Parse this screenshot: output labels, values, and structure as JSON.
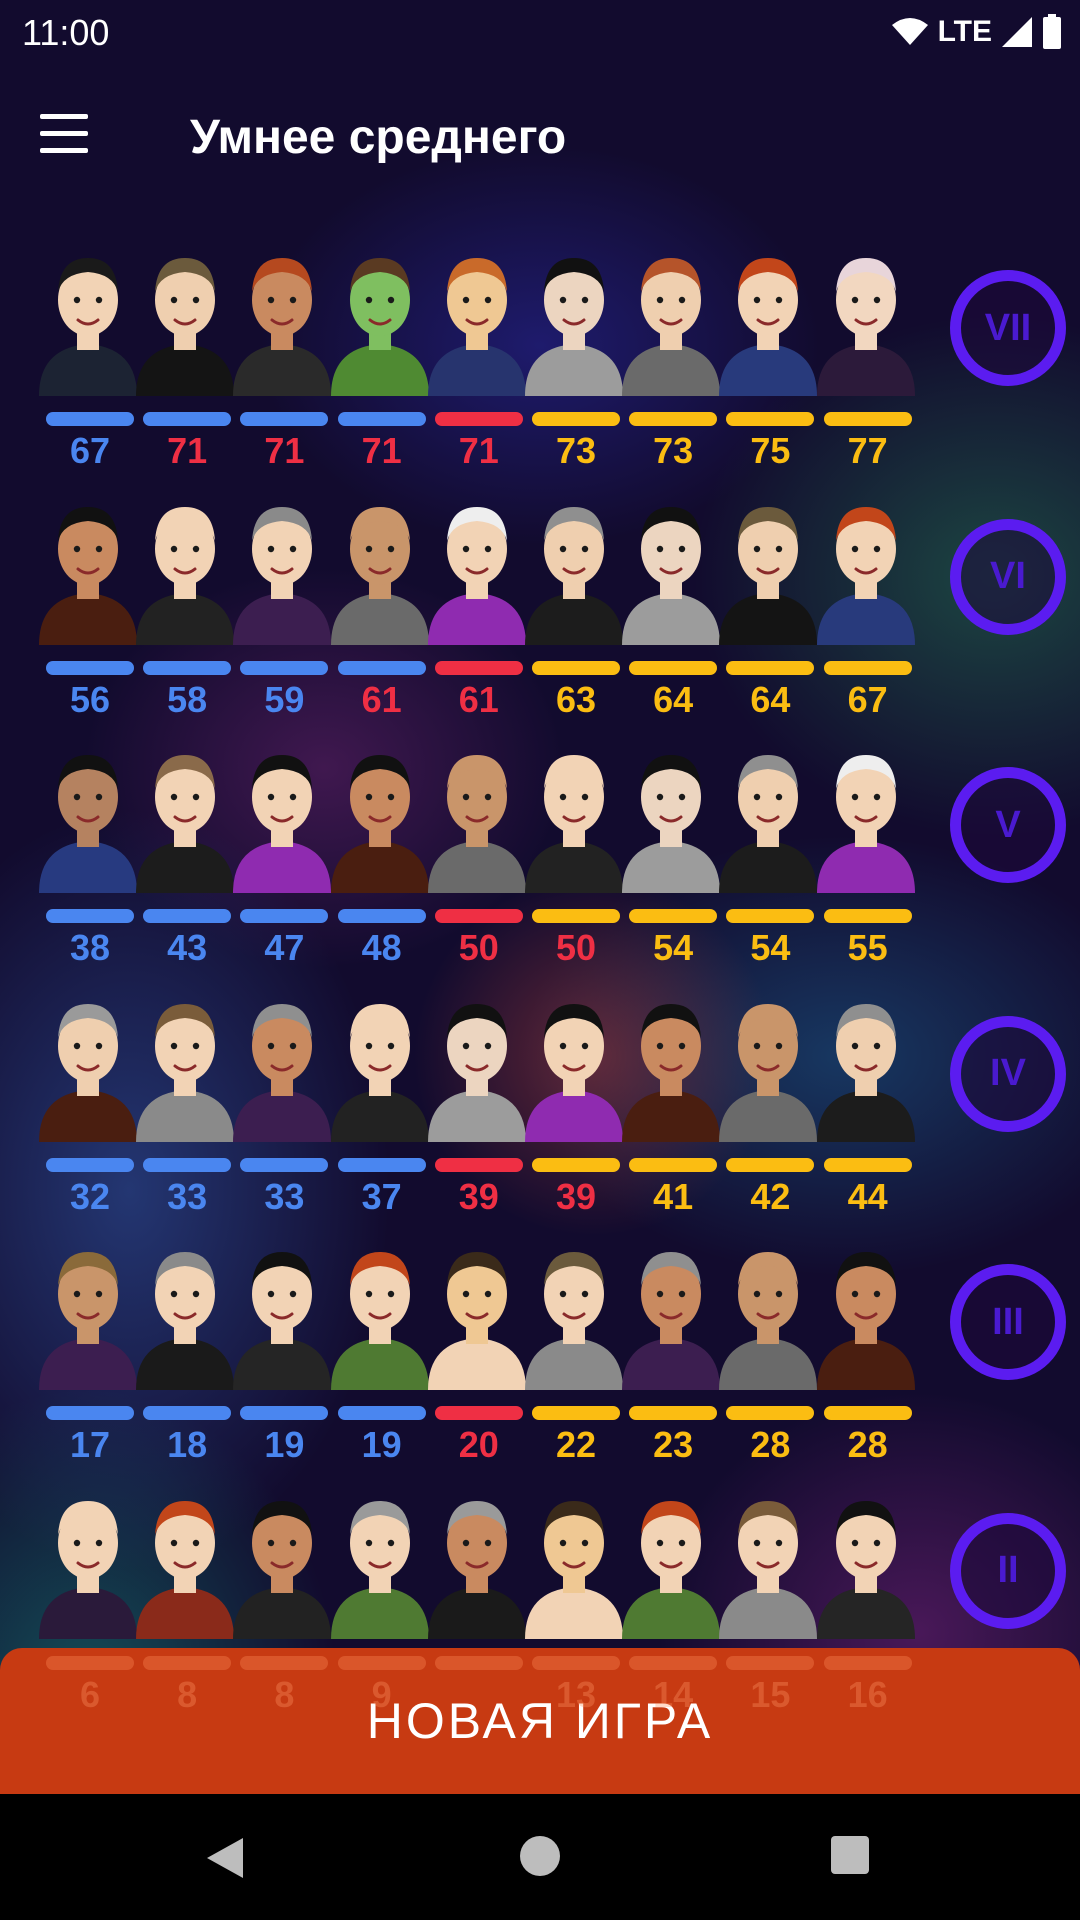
{
  "status_bar": {
    "time": "11:00",
    "network": "LTE"
  },
  "app_bar": {
    "title": "Умнее среднего"
  },
  "colors": {
    "blue": "#4a86f0",
    "red": "#ef2f44",
    "gold": "#fbbd12",
    "badge": "#5b1cf0",
    "button": "#c73a12"
  },
  "levels": [
    {
      "badge": "VII",
      "scores": [
        {
          "value": "67",
          "tone": "blue"
        },
        {
          "value": "71",
          "tone": "red"
        },
        {
          "value": "71",
          "tone": "red"
        },
        {
          "value": "71",
          "tone": "red"
        },
        {
          "value": "71",
          "tone": "red"
        },
        {
          "value": "73",
          "tone": "gold"
        },
        {
          "value": "73",
          "tone": "gold"
        },
        {
          "value": "75",
          "tone": "gold"
        },
        {
          "value": "77",
          "tone": "gold"
        }
      ],
      "bars": [
        "blue",
        "blue",
        "blue",
        "blue",
        "red",
        "gold",
        "gold",
        "gold",
        "gold"
      ]
    },
    {
      "badge": "VI",
      "scores": [
        {
          "value": "56",
          "tone": "blue"
        },
        {
          "value": "58",
          "tone": "blue"
        },
        {
          "value": "59",
          "tone": "blue"
        },
        {
          "value": "61",
          "tone": "red"
        },
        {
          "value": "61",
          "tone": "red"
        },
        {
          "value": "63",
          "tone": "gold"
        },
        {
          "value": "64",
          "tone": "gold"
        },
        {
          "value": "64",
          "tone": "gold"
        },
        {
          "value": "67",
          "tone": "gold"
        }
      ],
      "bars": [
        "blue",
        "blue",
        "blue",
        "blue",
        "red",
        "gold",
        "gold",
        "gold",
        "gold"
      ]
    },
    {
      "badge": "V",
      "scores": [
        {
          "value": "38",
          "tone": "blue"
        },
        {
          "value": "43",
          "tone": "blue"
        },
        {
          "value": "47",
          "tone": "blue"
        },
        {
          "value": "48",
          "tone": "blue"
        },
        {
          "value": "50",
          "tone": "red"
        },
        {
          "value": "50",
          "tone": "red"
        },
        {
          "value": "54",
          "tone": "gold"
        },
        {
          "value": "54",
          "tone": "gold"
        },
        {
          "value": "55",
          "tone": "gold"
        }
      ],
      "bars": [
        "blue",
        "blue",
        "blue",
        "blue",
        "red",
        "gold",
        "gold",
        "gold",
        "gold"
      ]
    },
    {
      "badge": "IV",
      "scores": [
        {
          "value": "32",
          "tone": "blue"
        },
        {
          "value": "33",
          "tone": "blue"
        },
        {
          "value": "33",
          "tone": "blue"
        },
        {
          "value": "37",
          "tone": "blue"
        },
        {
          "value": "39",
          "tone": "red"
        },
        {
          "value": "39",
          "tone": "red"
        },
        {
          "value": "41",
          "tone": "gold"
        },
        {
          "value": "42",
          "tone": "gold"
        },
        {
          "value": "44",
          "tone": "gold"
        }
      ],
      "bars": [
        "blue",
        "blue",
        "blue",
        "blue",
        "red",
        "gold",
        "gold",
        "gold",
        "gold"
      ]
    },
    {
      "badge": "III",
      "scores": [
        {
          "value": "17",
          "tone": "blue"
        },
        {
          "value": "18",
          "tone": "blue"
        },
        {
          "value": "19",
          "tone": "blue"
        },
        {
          "value": "19",
          "tone": "blue"
        },
        {
          "value": "20",
          "tone": "red"
        },
        {
          "value": "22",
          "tone": "gold"
        },
        {
          "value": "23",
          "tone": "gold"
        },
        {
          "value": "28",
          "tone": "gold"
        },
        {
          "value": "28",
          "tone": "gold"
        }
      ],
      "bars": [
        "blue",
        "blue",
        "blue",
        "blue",
        "red",
        "gold",
        "gold",
        "gold",
        "gold"
      ]
    },
    {
      "badge": "II",
      "scores": [],
      "bars": []
    }
  ],
  "hidden_row_scores": [
    "6",
    "8",
    "8",
    "9",
    "",
    "13",
    "14",
    "15",
    "16"
  ],
  "new_game_button": "НОВАЯ ИГРА",
  "avatars": [
    [
      {
        "skin": "#f2d3b5",
        "hair": "#1a1a1a",
        "shirt": "#1c2333"
      },
      {
        "skin": "#efcfaf",
        "hair": "#6b5a3c",
        "shirt": "#141414"
      },
      {
        "skin": "#c98a60",
        "hair": "#b5491f",
        "shirt": "#2a2a2a"
      },
      {
        "skin": "#7fbf60",
        "hair": "#5a3a22",
        "shirt": "#4f8a32"
      },
      {
        "skin": "#efc893",
        "hair": "#c96a2a",
        "shirt": "#27346e"
      },
      {
        "skin": "#ecd5c0",
        "hair": "#111111",
        "shirt": "#9c9c9c"
      },
      {
        "skin": "#efcfaf",
        "hair": "#b5542a",
        "shirt": "#6a6a6a"
      },
      {
        "skin": "#f2d3b5",
        "hair": "#c2461a",
        "shirt": "#283a7c"
      },
      {
        "skin": "#f2d7c0",
        "hair": "#e8d5da",
        "shirt": "#2c1a3a"
      }
    ],
    [
      {
        "skin": "#c98a60",
        "hair": "#111111",
        "shirt": "#4a1e10"
      },
      {
        "skin": "#f2d3b5",
        "hair": "#f2d3b5",
        "shirt": "#222222"
      },
      {
        "skin": "#f2d3b5",
        "hair": "#8a8a8a",
        "shirt": "#3c1e50"
      },
      {
        "skin": "#c9956a",
        "hair": "#c9956a",
        "shirt": "#6a6a6a"
      },
      {
        "skin": "#f2d3b5",
        "hair": "#eeeeee",
        "shirt": "#8f2bb0"
      },
      {
        "skin": "#efcfaf",
        "hair": "#8f8f8f",
        "shirt": "#1c1c1c"
      },
      {
        "skin": "#ecd5c0",
        "hair": "#111111",
        "shirt": "#9c9c9c"
      },
      {
        "skin": "#efcfaf",
        "hair": "#6b5a3c",
        "shirt": "#141414"
      },
      {
        "skin": "#f2d3b5",
        "hair": "#c2461a",
        "shirt": "#283a7c"
      }
    ],
    [
      {
        "skin": "#b58260",
        "hair": "#111111",
        "shirt": "#273a80"
      },
      {
        "skin": "#f2d3b5",
        "hair": "#8a6a4a",
        "shirt": "#1c1c1c"
      },
      {
        "skin": "#f2d3b5",
        "hair": "#111111",
        "shirt": "#8f2bb0"
      },
      {
        "skin": "#c98a60",
        "hair": "#111111",
        "shirt": "#4a1e10"
      },
      {
        "skin": "#c9956a",
        "hair": "#c9956a",
        "shirt": "#6a6a6a"
      },
      {
        "skin": "#f2d3b5",
        "hair": "#f2d3b5",
        "shirt": "#222222"
      },
      {
        "skin": "#ecd5c0",
        "hair": "#111111",
        "shirt": "#9c9c9c"
      },
      {
        "skin": "#efcfaf",
        "hair": "#8f8f8f",
        "shirt": "#1c1c1c"
      },
      {
        "skin": "#f2d3b5",
        "hair": "#eeeeee",
        "shirt": "#8f2bb0"
      }
    ],
    [
      {
        "skin": "#efcfaf",
        "hair": "#9a9a9a",
        "shirt": "#4a1e10"
      },
      {
        "skin": "#f2d3b5",
        "hair": "#7a5c3a",
        "shirt": "#8a8a8a"
      },
      {
        "skin": "#c98a60",
        "hair": "#8f8f8f",
        "shirt": "#3c1e50"
      },
      {
        "skin": "#f2d3b5",
        "hair": "#f2d3b5",
        "shirt": "#222222"
      },
      {
        "skin": "#ecd5c0",
        "hair": "#111111",
        "shirt": "#9c9c9c"
      },
      {
        "skin": "#f2d3b5",
        "hair": "#111111",
        "shirt": "#8f2bb0"
      },
      {
        "skin": "#c98a60",
        "hair": "#111111",
        "shirt": "#4a1e10"
      },
      {
        "skin": "#c9956a",
        "hair": "#c9956a",
        "shirt": "#6a6a6a"
      },
      {
        "skin": "#efcfaf",
        "hair": "#8f8f8f",
        "shirt": "#1c1c1c"
      }
    ],
    [
      {
        "skin": "#c9956a",
        "hair": "#8a6a3a",
        "shirt": "#3c1e50"
      },
      {
        "skin": "#f2d3b5",
        "hair": "#8a8a8a",
        "shirt": "#1a1a1a"
      },
      {
        "skin": "#f2d3b5",
        "hair": "#111111",
        "shirt": "#252525"
      },
      {
        "skin": "#f2d3b5",
        "hair": "#c2461a",
        "shirt": "#4f7a32"
      },
      {
        "skin": "#efc893",
        "hair": "#3a2a1a",
        "shirt": "#f2d3b5"
      },
      {
        "skin": "#f2d3b5",
        "hair": "#6b5a3c",
        "shirt": "#8a8a8a"
      },
      {
        "skin": "#c98a60",
        "hair": "#8f8f8f",
        "shirt": "#3c1e50"
      },
      {
        "skin": "#c9956a",
        "hair": "#c9956a",
        "shirt": "#6a6a6a"
      },
      {
        "skin": "#c98a60",
        "hair": "#111111",
        "shirt": "#4a1e10"
      }
    ],
    [
      {
        "skin": "#f2d3b5",
        "hair": "#f2d3b5",
        "shirt": "#2a1a3a"
      },
      {
        "skin": "#f2d3b5",
        "hair": "#c2461a",
        "shirt": "#8a2a1a"
      },
      {
        "skin": "#c98a60",
        "hair": "#111111",
        "shirt": "#222222"
      },
      {
        "skin": "#f2d3b5",
        "hair": "#9a9a9a",
        "shirt": "#4f7a32"
      },
      {
        "skin": "#c98a60",
        "hair": "#9a9a9a",
        "shirt": "#1a1a1a"
      },
      {
        "skin": "#efc893",
        "hair": "#3a2a1a",
        "shirt": "#f2d3b5"
      },
      {
        "skin": "#f2d3b5",
        "hair": "#c2461a",
        "shirt": "#4f7a32"
      },
      {
        "skin": "#f2d3b5",
        "hair": "#7a5c3a",
        "shirt": "#8a8a8a"
      },
      {
        "skin": "#f2d3b5",
        "hair": "#111111",
        "shirt": "#252525"
      }
    ]
  ]
}
